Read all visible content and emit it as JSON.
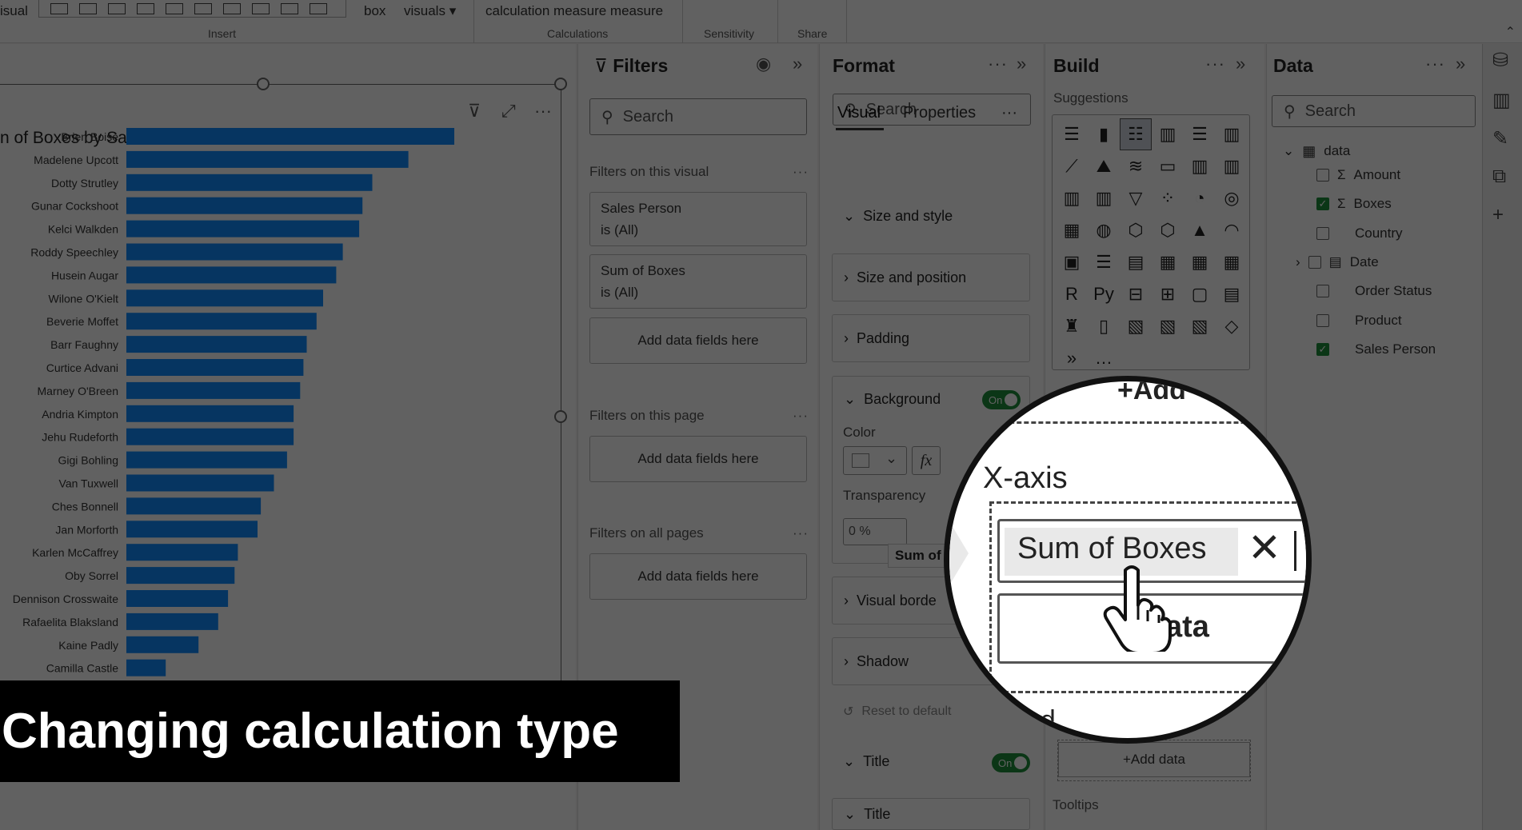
{
  "ribbon": {
    "left_fragment": "isual",
    "box_label": "box",
    "visuals_label": "visuals",
    "calc_label": "calculation measure measure",
    "groups": [
      "Insert",
      "Calculations",
      "Sensitivity",
      "Share"
    ]
  },
  "visual": {
    "title_fragment": "n of Boxes by Sales Person"
  },
  "chart_data": {
    "type": "bar",
    "orientation": "horizontal",
    "title": "n of Boxes by Sales Person",
    "bar_color": "#118dff",
    "categories": [
      "Brien Boise",
      "Madelene Upcott",
      "Dotty Strutley",
      "Gunar Cockshoot",
      "Kelci Walkden",
      "Roddy Speechley",
      "Husein Augar",
      "Wilone O'Kielt",
      "Beverie Moffet",
      "Barr Faughny",
      "Curtice Advani",
      "Marney O'Breen",
      "Andria Kimpton",
      "Jehu Rudeforth",
      "Gigi Bohling",
      "Van Tuxwell",
      "Ches Bonnell",
      "Jan Morforth",
      "Karlen McCaffrey",
      "Oby Sorrel",
      "Dennison Crosswaite",
      "Rafaelita Blaksland",
      "Kaine Padly",
      "Camilla Castle"
    ],
    "values": [
      100,
      86,
      75,
      72,
      71,
      66,
      64,
      60,
      58,
      55,
      54,
      53,
      51,
      51,
      49,
      45,
      41,
      40,
      34,
      33,
      31,
      28,
      22,
      12
    ],
    "xlabel": "",
    "ylabel": "",
    "grid": false
  },
  "filters": {
    "title": "Filters",
    "search_placeholder": "Search",
    "on_visual_label": "Filters on this visual",
    "card1_field": "Sales Person",
    "card1_state": "is (All)",
    "card2_field": "Sum of Boxes",
    "card2_state": "is (All)",
    "add_fields": "Add data fields here",
    "on_page_label": "Filters on this page",
    "on_all_label": "Filters on all pages",
    "dots": "···"
  },
  "format": {
    "title": "Format",
    "search_placeholder": "Search",
    "tab_visual": "Visual",
    "tab_properties": "Properties",
    "size_style": "Size and style",
    "size_position": "Size and position",
    "padding": "Padding",
    "background": "Background",
    "toggle_on": "On",
    "color_label": "Color",
    "fx": "fx",
    "transparency_label": "Transparency",
    "transparency_value": "0 %",
    "tooltip_fragment": "Sum of",
    "visual_border": "Visual borde",
    "shadow": "Shadow",
    "reset": "Reset to default",
    "title_section": "Title",
    "title_sub": "Title"
  },
  "build": {
    "title": "Build",
    "suggestions": "Suggestions",
    "add_data": "+Add data",
    "tooltips": "Tooltips"
  },
  "data_pane": {
    "title": "Data",
    "search_placeholder": "Search",
    "table": "data",
    "fields": [
      {
        "name": "Amount",
        "sigma": true,
        "checked": false
      },
      {
        "name": "Boxes",
        "sigma": true,
        "checked": true
      },
      {
        "name": "Country",
        "sigma": false,
        "checked": false
      },
      {
        "name": "Date",
        "sigma": false,
        "checked": false
      },
      {
        "name": "Order Status",
        "sigma": false,
        "checked": false
      },
      {
        "name": "Product",
        "sigma": false,
        "checked": false
      },
      {
        "name": "Sales Person",
        "sigma": false,
        "checked": true
      }
    ]
  },
  "magnifier": {
    "add_fragment": "+Add",
    "axis_label": "X-axis",
    "field_text": "Sum of Boxes",
    "add_data_fragment": "d data",
    "legend_fragment": "nd"
  },
  "caption": "Changing calculation type"
}
